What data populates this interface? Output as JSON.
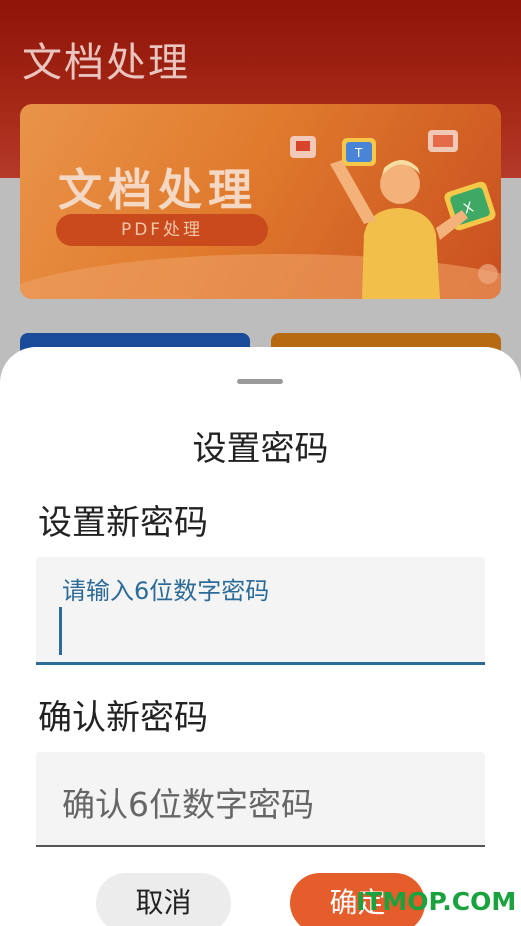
{
  "app": {
    "title": "文档处理",
    "banner": {
      "title": "文档处理",
      "subtitle": "PDF处理"
    }
  },
  "dialog": {
    "title": "设置密码",
    "new_password": {
      "label": "设置新密码",
      "placeholder": "请输入6位数字密码"
    },
    "confirm_password": {
      "label": "确认新密码",
      "placeholder": "确认6位数字密码"
    },
    "cancel_label": "取消",
    "ok_label": "确定"
  },
  "watermark": "ITMOP.COM",
  "colors": {
    "accent_orange": "#e55d2a",
    "field_focus": "#2c6b98",
    "header_red": "#a62817"
  }
}
